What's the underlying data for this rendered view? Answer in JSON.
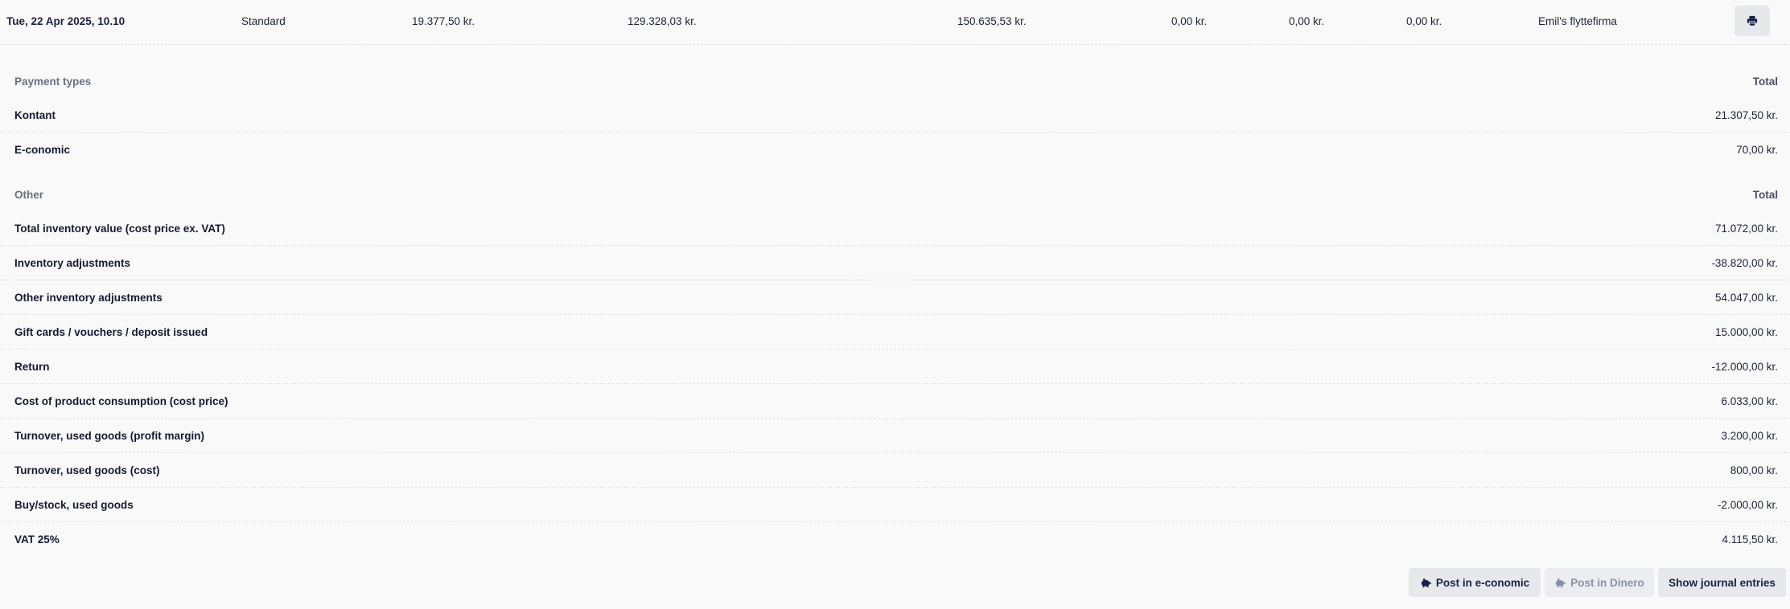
{
  "summary_row": {
    "date": "Tue, 22 Apr 2025, 10.10",
    "type": "Standard",
    "amount_1": "19.377,50 kr.",
    "amount_2": "129.328,03 kr.",
    "amount_3": "150.635,53 kr.",
    "amount_4": "0,00 kr.",
    "amount_5": "0,00 kr.",
    "amount_6": "0,00 kr.",
    "company": "Emil's flyttefirma",
    "print_icon": "print-icon"
  },
  "payment_types": {
    "header_label": "Payment types",
    "header_total": "Total",
    "rows": [
      {
        "label": "Kontant",
        "value": "21.307,50 kr."
      },
      {
        "label": "E-conomic",
        "value": "70,00 kr."
      }
    ]
  },
  "other": {
    "header_label": "Other",
    "header_total": "Total",
    "rows": [
      {
        "label": "Total inventory value (cost price ex. VAT)",
        "value": "71.072,00 kr."
      },
      {
        "label": "Inventory adjustments",
        "value": "-38.820,00 kr."
      },
      {
        "label": "Other inventory adjustments",
        "value": "54.047,00 kr."
      },
      {
        "label": "Gift cards / vouchers / deposit issued",
        "value": "15.000,00 kr."
      },
      {
        "label": "Return",
        "value": "-12.000,00 kr."
      },
      {
        "label": "Cost of product consumption (cost price)",
        "value": "6.033,00 kr."
      },
      {
        "label": "Turnover, used goods (profit margin)",
        "value": "3.200,00 kr."
      },
      {
        "label": "Turnover, used goods (cost)",
        "value": "800,00 kr."
      },
      {
        "label": "Buy/stock, used goods",
        "value": "-2.000,00 kr."
      },
      {
        "label": "VAT 25%",
        "value": "4.115,50 kr."
      }
    ]
  },
  "actions": {
    "post_economic": "Post in e-conomic",
    "post_dinero": "Post in Dinero",
    "show_journal": "Show journal entries",
    "colors": {
      "button_bg": "#e6e8ec",
      "button_text": "#1b2146",
      "disabled_text": "#8a90a8"
    }
  }
}
